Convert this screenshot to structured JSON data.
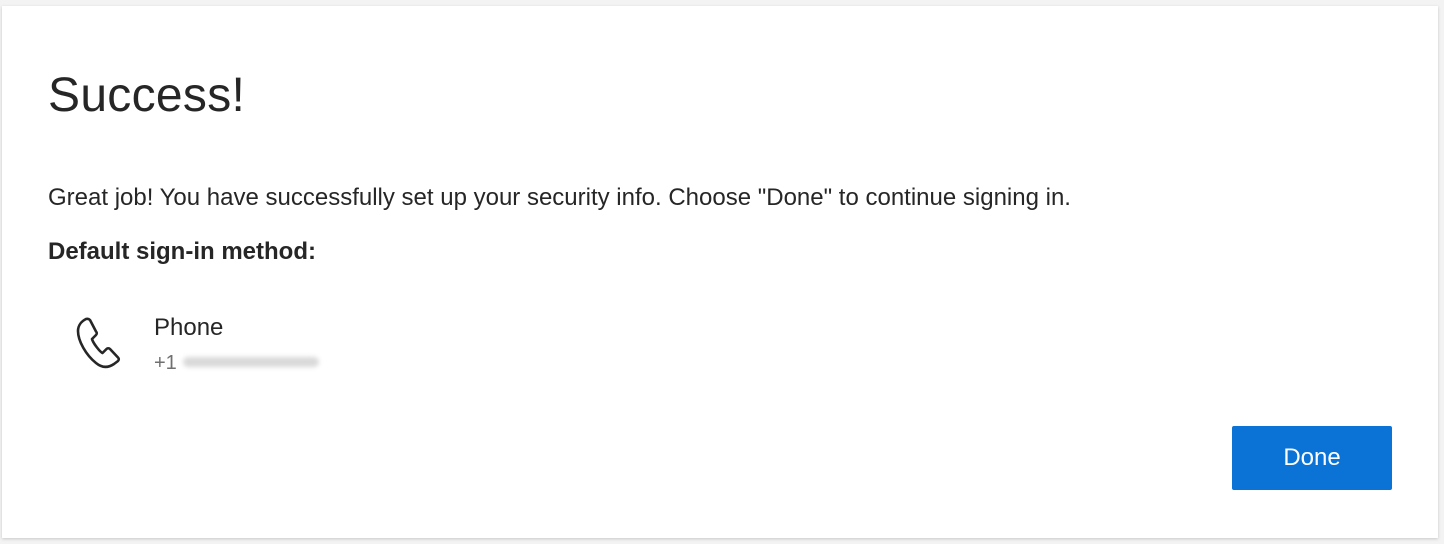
{
  "dialog": {
    "title": "Success!",
    "message": "Great job! You have successfully set up your security info. Choose \"Done\" to continue signing in.",
    "default_label": "Default sign-in method:",
    "method": {
      "icon": "phone-icon",
      "name": "Phone",
      "country_code": "+1"
    },
    "done_label": "Done"
  },
  "colors": {
    "accent": "#0b72d6",
    "text": "#262626",
    "secondary_text": "#707070",
    "background": "#ffffff"
  }
}
